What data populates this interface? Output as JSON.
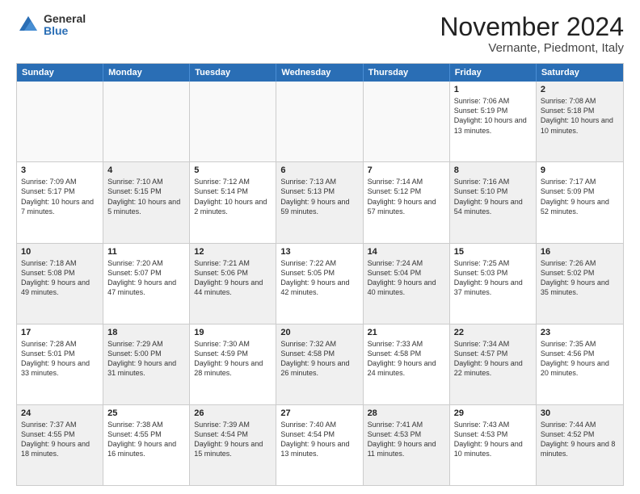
{
  "logo": {
    "general": "General",
    "blue": "Blue"
  },
  "title": "November 2024",
  "subtitle": "Vernante, Piedmont, Italy",
  "header": {
    "days": [
      "Sunday",
      "Monday",
      "Tuesday",
      "Wednesday",
      "Thursday",
      "Friday",
      "Saturday"
    ]
  },
  "rows": [
    [
      {
        "day": "",
        "info": "",
        "empty": true
      },
      {
        "day": "",
        "info": "",
        "empty": true
      },
      {
        "day": "",
        "info": "",
        "empty": true
      },
      {
        "day": "",
        "info": "",
        "empty": true
      },
      {
        "day": "",
        "info": "",
        "empty": true
      },
      {
        "day": "1",
        "info": "Sunrise: 7:06 AM\nSunset: 5:19 PM\nDaylight: 10 hours\nand 13 minutes."
      },
      {
        "day": "2",
        "info": "Sunrise: 7:08 AM\nSunset: 5:18 PM\nDaylight: 10 hours\nand 10 minutes.",
        "shaded": true
      }
    ],
    [
      {
        "day": "3",
        "info": "Sunrise: 7:09 AM\nSunset: 5:17 PM\nDaylight: 10 hours\nand 7 minutes."
      },
      {
        "day": "4",
        "info": "Sunrise: 7:10 AM\nSunset: 5:15 PM\nDaylight: 10 hours\nand 5 minutes.",
        "shaded": true
      },
      {
        "day": "5",
        "info": "Sunrise: 7:12 AM\nSunset: 5:14 PM\nDaylight: 10 hours\nand 2 minutes."
      },
      {
        "day": "6",
        "info": "Sunrise: 7:13 AM\nSunset: 5:13 PM\nDaylight: 9 hours\nand 59 minutes.",
        "shaded": true
      },
      {
        "day": "7",
        "info": "Sunrise: 7:14 AM\nSunset: 5:12 PM\nDaylight: 9 hours\nand 57 minutes."
      },
      {
        "day": "8",
        "info": "Sunrise: 7:16 AM\nSunset: 5:10 PM\nDaylight: 9 hours\nand 54 minutes.",
        "shaded": true
      },
      {
        "day": "9",
        "info": "Sunrise: 7:17 AM\nSunset: 5:09 PM\nDaylight: 9 hours\nand 52 minutes."
      }
    ],
    [
      {
        "day": "10",
        "info": "Sunrise: 7:18 AM\nSunset: 5:08 PM\nDaylight: 9 hours\nand 49 minutes.",
        "shaded": true
      },
      {
        "day": "11",
        "info": "Sunrise: 7:20 AM\nSunset: 5:07 PM\nDaylight: 9 hours\nand 47 minutes."
      },
      {
        "day": "12",
        "info": "Sunrise: 7:21 AM\nSunset: 5:06 PM\nDaylight: 9 hours\nand 44 minutes.",
        "shaded": true
      },
      {
        "day": "13",
        "info": "Sunrise: 7:22 AM\nSunset: 5:05 PM\nDaylight: 9 hours\nand 42 minutes."
      },
      {
        "day": "14",
        "info": "Sunrise: 7:24 AM\nSunset: 5:04 PM\nDaylight: 9 hours\nand 40 minutes.",
        "shaded": true
      },
      {
        "day": "15",
        "info": "Sunrise: 7:25 AM\nSunset: 5:03 PM\nDaylight: 9 hours\nand 37 minutes."
      },
      {
        "day": "16",
        "info": "Sunrise: 7:26 AM\nSunset: 5:02 PM\nDaylight: 9 hours\nand 35 minutes.",
        "shaded": true
      }
    ],
    [
      {
        "day": "17",
        "info": "Sunrise: 7:28 AM\nSunset: 5:01 PM\nDaylight: 9 hours\nand 33 minutes."
      },
      {
        "day": "18",
        "info": "Sunrise: 7:29 AM\nSunset: 5:00 PM\nDaylight: 9 hours\nand 31 minutes.",
        "shaded": true
      },
      {
        "day": "19",
        "info": "Sunrise: 7:30 AM\nSunset: 4:59 PM\nDaylight: 9 hours\nand 28 minutes."
      },
      {
        "day": "20",
        "info": "Sunrise: 7:32 AM\nSunset: 4:58 PM\nDaylight: 9 hours\nand 26 minutes.",
        "shaded": true
      },
      {
        "day": "21",
        "info": "Sunrise: 7:33 AM\nSunset: 4:58 PM\nDaylight: 9 hours\nand 24 minutes."
      },
      {
        "day": "22",
        "info": "Sunrise: 7:34 AM\nSunset: 4:57 PM\nDaylight: 9 hours\nand 22 minutes.",
        "shaded": true
      },
      {
        "day": "23",
        "info": "Sunrise: 7:35 AM\nSunset: 4:56 PM\nDaylight: 9 hours\nand 20 minutes."
      }
    ],
    [
      {
        "day": "24",
        "info": "Sunrise: 7:37 AM\nSunset: 4:55 PM\nDaylight: 9 hours\nand 18 minutes.",
        "shaded": true
      },
      {
        "day": "25",
        "info": "Sunrise: 7:38 AM\nSunset: 4:55 PM\nDaylight: 9 hours\nand 16 minutes."
      },
      {
        "day": "26",
        "info": "Sunrise: 7:39 AM\nSunset: 4:54 PM\nDaylight: 9 hours\nand 15 minutes.",
        "shaded": true
      },
      {
        "day": "27",
        "info": "Sunrise: 7:40 AM\nSunset: 4:54 PM\nDaylight: 9 hours\nand 13 minutes."
      },
      {
        "day": "28",
        "info": "Sunrise: 7:41 AM\nSunset: 4:53 PM\nDaylight: 9 hours\nand 11 minutes.",
        "shaded": true
      },
      {
        "day": "29",
        "info": "Sunrise: 7:43 AM\nSunset: 4:53 PM\nDaylight: 9 hours\nand 10 minutes."
      },
      {
        "day": "30",
        "info": "Sunrise: 7:44 AM\nSunset: 4:52 PM\nDaylight: 9 hours\nand 8 minutes.",
        "shaded": true
      }
    ]
  ]
}
